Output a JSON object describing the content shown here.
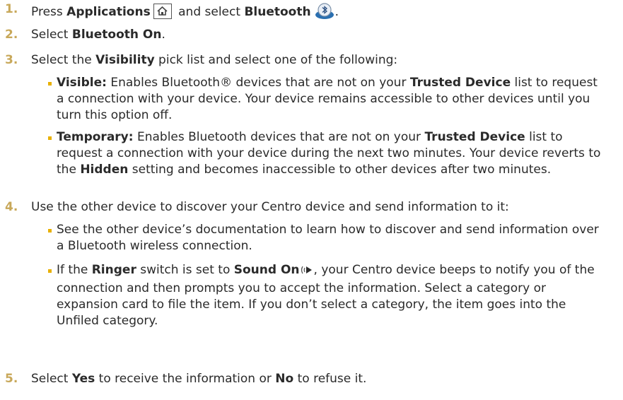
{
  "steps": [
    {
      "num": "1.",
      "a": "Press ",
      "b1": "Applications",
      "c": " and select ",
      "b2": "Bluetooth",
      "d": "."
    },
    {
      "num": "2.",
      "a": "Select ",
      "b1": "Bluetooth On",
      "d": "."
    },
    {
      "num": "3.",
      "a": "Select the ",
      "b1": "Visibility",
      "c": " pick list and select one of the following:"
    },
    {
      "num": "4.",
      "a": "Use the other device to discover your Centro device and send information to it:"
    },
    {
      "num": "5.",
      "a": "Select ",
      "b1": "Yes",
      "c": " to receive the information or ",
      "b2": "No",
      "d": " to refuse it."
    }
  ],
  "visibility_options": [
    {
      "label": "Visible:",
      "t1": " Enables Bluetooth® devices that are not on your ",
      "b": "Trusted Device",
      "t2": " list to request a connection with your device. Your device remains accessible to other devices until you turn this option off."
    },
    {
      "label": "Temporary:",
      "t1": " Enables Bluetooth devices that are not on your ",
      "b": "Trusted Device",
      "t2": " list to request a connection with your device during the next two minutes. Your device reverts to the ",
      "b2": "Hidden",
      "t3": " setting and becomes inaccessible to other devices after two minutes."
    }
  ],
  "discover_bullets": [
    {
      "t1": "See the other device’s documentation to learn how to discover and send information over a Bluetooth wireless connection."
    },
    {
      "t1": "If the ",
      "b1": "Ringer",
      "t2": " switch is set to ",
      "b2": "Sound On",
      "t3": ", your Centro device beeps to notify you of the connection and then prompts you to accept the information. Select a category or expansion card to file the item. If you don’t select a category, the item goes into the Unfiled category."
    }
  ],
  "icons": {
    "applications": "home-icon",
    "bluetooth": "bluetooth-icon",
    "ringer": "ringer-sound-on-icon"
  },
  "colors": {
    "step_number": "#c8a85a",
    "bullet": "#e8b000",
    "text": "#2a2a2a"
  }
}
